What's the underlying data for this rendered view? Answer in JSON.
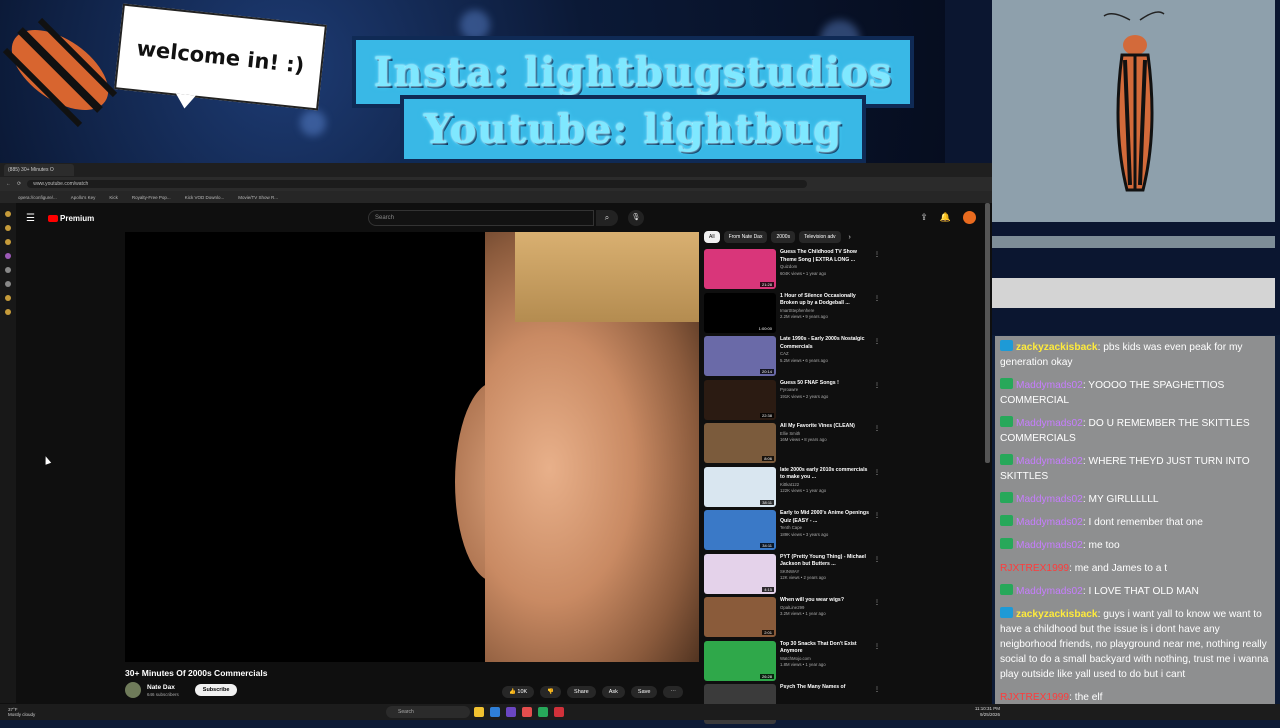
{
  "overlay": {
    "welcome": "welcome in! :)",
    "insta": "Insta: lightbugstudios",
    "youtube": "Youtube: lightbug"
  },
  "browser": {
    "tab_title": "(885) 30+ Minutes O",
    "url": "www.youtube.com/watch",
    "bookmarks": [
      "opera://configure/...",
      "Apollo's Key",
      "Kick",
      "Royalty-Free Pop...",
      "Kick VOD Downlo...",
      "Movie/TV Show R..."
    ]
  },
  "youtube": {
    "logo": "Premium",
    "search_placeholder": "Search",
    "video_title": "30+ Minutes Of 2000s Commercials",
    "channel": "Nate Dax",
    "subscribers": "646 subscribers",
    "subscribe": "Subscribe",
    "likes": "10K",
    "share": "Share",
    "ask": "Ask",
    "save": "Save",
    "chips": [
      "All",
      "From Nate Dax",
      "2000s",
      "Television adv"
    ],
    "recommendations": [
      {
        "title": "Guess The Childhood TV Show Theme Song | EXTRA LONG ...",
        "channel": "Quizdom",
        "meta": "604K views • 1 year ago",
        "duration": "21:28",
        "color": "#d9367a"
      },
      {
        "title": "1 Hour of Silence Occasionally Broken up by a Dodgeball ...",
        "channel": "ImartStephenhere",
        "meta": "2.2M views • 9 years ago",
        "duration": "1:00:00",
        "color": "#000000"
      },
      {
        "title": "Late 1990s - Early 2000s Nostalgic Commercials",
        "channel": "CAZ",
        "meta": "5.2M views • 6 years ago",
        "duration": "20:14",
        "color": "#6a6aa8"
      },
      {
        "title": "Guess 50 FNAF Songs !",
        "channel": "Pyroawre",
        "meta": "191K views • 2 years ago",
        "duration": "22:38",
        "color": "#2b1b12"
      },
      {
        "title": "All My Favorite Vines (CLEAN)",
        "channel": "Ellie Smith",
        "meta": "16M views • 8 years ago",
        "duration": "8:06",
        "color": "#7b5b3c"
      },
      {
        "title": "late 2000s early 2010s commercials to make you ...",
        "channel": "Kittkat122",
        "meta": "122K views • 1 year ago",
        "duration": "38:11",
        "color": "#d9e6f0"
      },
      {
        "title": "Early to Mid 2000's Anime Openings Quiz (EASY - ...",
        "channel": "Tenth Cape",
        "meta": "189K views • 3 years ago",
        "duration": "34:11",
        "color": "#3a79c7"
      },
      {
        "title": "PYT (Pretty Young Thing) - Michael Jackson but Butters ...",
        "channel": "SKINWAY",
        "meta": "12K views • 2 years ago",
        "duration": "4:15",
        "color": "#e4d2ea"
      },
      {
        "title": "When will you wear wigs?",
        "channel": "OpalLine299",
        "meta": "3.2M views • 1 year ago",
        "duration": "2:01",
        "color": "#8a5b3a"
      },
      {
        "title": "Top 30 Snacks That Don't Exist Anymore",
        "channel": "WatchMojo.com",
        "meta": "1.8M views • 1 year ago",
        "duration": "26:28",
        "color": "#2fa84a"
      },
      {
        "title": "Psych The Many Names of",
        "channel": "",
        "meta": "",
        "duration": "",
        "color": "#3b3b3b"
      }
    ]
  },
  "chat": [
    {
      "badge": "b1",
      "user": "zackyzackisback",
      "ucls": "u1",
      "text": ": pbs kids was even peak for my generation okay"
    },
    {
      "badge": "b2",
      "user": "Maddymads02",
      "ucls": "u2",
      "text": ": YOOOO THE SPAGHETTIOS COMMERCIAL"
    },
    {
      "badge": "b2",
      "user": "Maddymads02",
      "ucls": "u2",
      "text": ": DO U REMEMBER THE SKITTLES COMMERCIALS"
    },
    {
      "badge": "b2",
      "user": "Maddymads02",
      "ucls": "u2",
      "text": ": WHERE THEYD JUST TURN INTO SKITTLES"
    },
    {
      "badge": "b2",
      "user": "Maddymads02",
      "ucls": "u2",
      "text": ": MY GIRLLLLLL"
    },
    {
      "badge": "b2",
      "user": "Maddymads02",
      "ucls": "u2",
      "text": ": I dont remember that one"
    },
    {
      "badge": "b2",
      "user": "Maddymads02",
      "ucls": "u2",
      "text": ": me too"
    },
    {
      "badge": "",
      "user": "RJXTREX1999",
      "ucls": "u3",
      "text": ": me and James to a t"
    },
    {
      "badge": "b2",
      "user": "Maddymads02",
      "ucls": "u2",
      "text": ": I LOVE THAT OLD MAN"
    },
    {
      "badge": "b1",
      "user": "zackyzackisback",
      "ucls": "u1",
      "text": ": guys i want yall to know we want to have a childhood but the issue is i dont have any neigborhood friends, no playground near me, nothing really social to do a small backyard with nothing, trust me i wanna play outside like yall used to do but i cant"
    },
    {
      "badge": "",
      "user": "RJXTREX1999",
      "ucls": "u3",
      "text": ": the elf"
    }
  ],
  "taskbar": {
    "weather_temp": "37°F",
    "weather_desc": "Mostly cloudy",
    "search": "Search",
    "time": "11:10:31 PM",
    "date": "9/25/2026"
  }
}
